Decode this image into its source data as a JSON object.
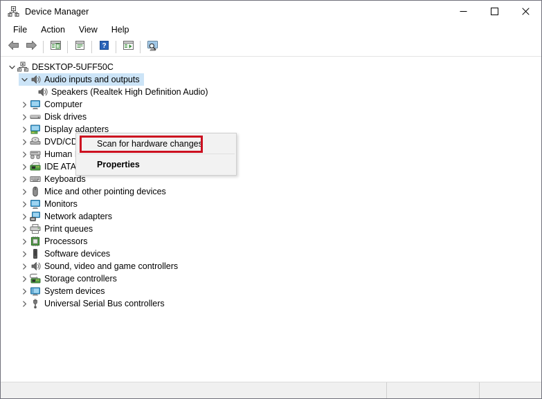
{
  "window": {
    "title": "Device Manager",
    "app_icon": "device-manager-icon",
    "caption": {
      "minimize_label": "Minimize",
      "maximize_label": "Maximize",
      "close_label": "Close"
    }
  },
  "menubar": {
    "items": [
      {
        "label": "File",
        "name": "menu-file"
      },
      {
        "label": "Action",
        "name": "menu-action"
      },
      {
        "label": "View",
        "name": "menu-view"
      },
      {
        "label": "Help",
        "name": "menu-help"
      }
    ]
  },
  "toolbar": {
    "buttons": [
      {
        "icon": "back-arrow-icon",
        "name": "toolbar-back"
      },
      {
        "icon": "forward-arrow-icon",
        "name": "toolbar-forward"
      },
      {
        "icon": "show-hide-console-tree-icon",
        "name": "toolbar-console-tree"
      },
      {
        "icon": "properties-icon",
        "name": "toolbar-properties"
      },
      {
        "icon": "help-question-icon",
        "name": "toolbar-help"
      },
      {
        "icon": "update-driver-icon",
        "name": "toolbar-update-driver"
      },
      {
        "icon": "scan-for-hardware-changes-icon",
        "name": "toolbar-scan-hardware"
      }
    ]
  },
  "tree": {
    "root": {
      "label": "DESKTOP-5UFF50C",
      "icon": "computer-node-icon",
      "expanded": true,
      "indent": 0
    },
    "items": [
      {
        "label": "Audio inputs and outputs",
        "icon": "speaker-icon",
        "expanded": true,
        "selected": true,
        "indent": 1
      },
      {
        "label": "Speakers (Realtek High Definition Audio)",
        "icon": "speaker-icon",
        "expanded": null,
        "selected": false,
        "indent": 2
      },
      {
        "label": "Computer",
        "icon": "monitor-icon",
        "expanded": false,
        "selected": false,
        "indent": 1
      },
      {
        "label": "Disk drives",
        "icon": "disk-drive-icon",
        "expanded": false,
        "selected": false,
        "indent": 1
      },
      {
        "label": "Display adapters",
        "icon": "display-adapter-icon",
        "expanded": false,
        "selected": false,
        "indent": 1
      },
      {
        "label": "DVD/CD-ROM drives",
        "icon": "optical-drive-icon",
        "expanded": false,
        "selected": false,
        "indent": 1
      },
      {
        "label": "Human Interface Devices",
        "icon": "hid-icon",
        "expanded": false,
        "selected": false,
        "indent": 1
      },
      {
        "label": "IDE ATA/ATAPI controllers",
        "icon": "ide-controller-icon",
        "expanded": false,
        "selected": false,
        "indent": 1
      },
      {
        "label": "Keyboards",
        "icon": "keyboard-icon",
        "expanded": false,
        "selected": false,
        "indent": 1
      },
      {
        "label": "Mice and other pointing devices",
        "icon": "mouse-icon",
        "expanded": false,
        "selected": false,
        "indent": 1
      },
      {
        "label": "Monitors",
        "icon": "monitor-icon",
        "expanded": false,
        "selected": false,
        "indent": 1
      },
      {
        "label": "Network adapters",
        "icon": "network-adapter-icon",
        "expanded": false,
        "selected": false,
        "indent": 1
      },
      {
        "label": "Print queues",
        "icon": "printer-icon",
        "expanded": false,
        "selected": false,
        "indent": 1
      },
      {
        "label": "Processors",
        "icon": "processor-icon",
        "expanded": false,
        "selected": false,
        "indent": 1
      },
      {
        "label": "Software devices",
        "icon": "software-device-icon",
        "expanded": false,
        "selected": false,
        "indent": 1
      },
      {
        "label": "Sound, video and game controllers",
        "icon": "speaker-icon",
        "expanded": false,
        "selected": false,
        "indent": 1
      },
      {
        "label": "Storage controllers",
        "icon": "storage-controller-icon",
        "expanded": false,
        "selected": false,
        "indent": 1
      },
      {
        "label": "System devices",
        "icon": "system-device-icon",
        "expanded": false,
        "selected": false,
        "indent": 1
      },
      {
        "label": "Universal Serial Bus controllers",
        "icon": "usb-icon",
        "expanded": false,
        "selected": false,
        "indent": 1
      }
    ]
  },
  "context_menu": {
    "items": [
      {
        "label": "Scan for hardware changes",
        "bold": false,
        "highlighted": true,
        "name": "context-scan-for-hardware-changes"
      },
      {
        "label": "Properties",
        "bold": true,
        "highlighted": false,
        "name": "context-properties"
      }
    ],
    "highlight_color": "#cc1020"
  },
  "statusbar": {
    "pane1": "",
    "pane2": "",
    "pane3": ""
  },
  "colors": {
    "selection": "#cce4f7",
    "annotation_red": "#cc1020",
    "window_border": "#6f6f7a"
  }
}
